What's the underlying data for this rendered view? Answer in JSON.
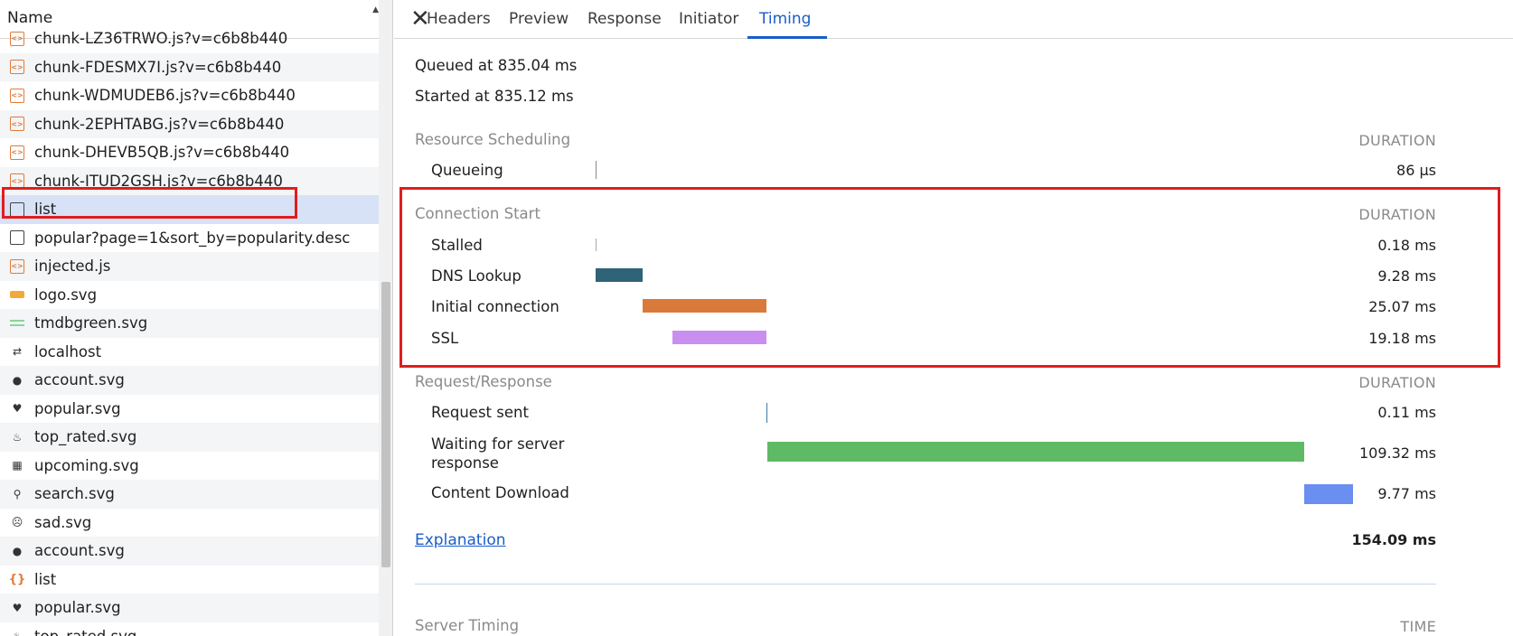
{
  "left_panel": {
    "column_header": "Name",
    "sort_indicator": "▲",
    "requests": [
      {
        "name": "chunk-LZ36TRWO.js?v=c6b8b440",
        "icon": "script-icon",
        "alt": false,
        "selected": false
      },
      {
        "name": "chunk-FDESMX7I.js?v=c6b8b440",
        "icon": "script-icon",
        "alt": true,
        "selected": false
      },
      {
        "name": "chunk-WDMUDEB6.js?v=c6b8b440",
        "icon": "script-icon",
        "alt": false,
        "selected": false
      },
      {
        "name": "chunk-2EPHTABG.js?v=c6b8b440",
        "icon": "script-icon",
        "alt": true,
        "selected": false
      },
      {
        "name": "chunk-DHEVB5QB.js?v=c6b8b440",
        "icon": "script-icon",
        "alt": false,
        "selected": false
      },
      {
        "name": "chunk-ITUD2GSH.js?v=c6b8b440",
        "icon": "script-icon",
        "alt": true,
        "selected": false
      },
      {
        "name": "list",
        "icon": "document-icon",
        "alt": false,
        "selected": true
      },
      {
        "name": "popular?page=1&sort_by=popularity.desc",
        "icon": "document-icon",
        "alt": false,
        "selected": false
      },
      {
        "name": "injected.js",
        "icon": "script-icon",
        "alt": true,
        "selected": false
      },
      {
        "name": "logo.svg",
        "icon": "image-icon",
        "alt": false,
        "selected": false
      },
      {
        "name": "tmdbgreen.svg",
        "icon": "image-green-icon",
        "alt": true,
        "selected": false
      },
      {
        "name": "localhost",
        "icon": "redirect-icon",
        "alt": false,
        "selected": false
      },
      {
        "name": "account.svg",
        "icon": "account-icon",
        "alt": true,
        "selected": false
      },
      {
        "name": "popular.svg",
        "icon": "heart-icon",
        "alt": false,
        "selected": false
      },
      {
        "name": "top_rated.svg",
        "icon": "flame-icon",
        "alt": true,
        "selected": false
      },
      {
        "name": "upcoming.svg",
        "icon": "calendar-icon",
        "alt": false,
        "selected": false
      },
      {
        "name": "search.svg",
        "icon": "search-icon",
        "alt": true,
        "selected": false
      },
      {
        "name": "sad.svg",
        "icon": "sad-face-icon",
        "alt": false,
        "selected": false
      },
      {
        "name": "account.svg",
        "icon": "account-icon",
        "alt": true,
        "selected": false
      },
      {
        "name": "list",
        "icon": "json-icon",
        "alt": false,
        "selected": false
      },
      {
        "name": "popular.svg",
        "icon": "heart-icon",
        "alt": true,
        "selected": false
      },
      {
        "name": "top_rated.svg",
        "icon": "flame-icon",
        "alt": false,
        "selected": false
      }
    ]
  },
  "tabs": {
    "close_label": "✕",
    "items": [
      "Headers",
      "Preview",
      "Response",
      "Initiator",
      "Timing"
    ],
    "active": "Timing"
  },
  "timing": {
    "queued_at": "Queued at 835.04 ms",
    "started_at": "Started at 835.12 ms",
    "duration_header": "DURATION",
    "sections": [
      {
        "title": "Resource Scheduling",
        "rows": [
          {
            "label": "Queueing",
            "value": "86 µs",
            "color": "#8a8a8a"
          }
        ]
      },
      {
        "title": "Connection Start",
        "rows": [
          {
            "label": "Stalled",
            "value": "0.18 ms",
            "color": "#a8a8a8"
          },
          {
            "label": "DNS Lookup",
            "value": "9.28 ms",
            "color": "#2e6378"
          },
          {
            "label": "Initial connection",
            "value": "25.07 ms",
            "color": "#d97a3b"
          },
          {
            "label": "SSL",
            "value": "19.18 ms",
            "color": "#c98ff0"
          }
        ]
      },
      {
        "title": "Request/Response",
        "rows": [
          {
            "label": "Request sent",
            "value": "0.11 ms",
            "color": "#3a7aa8"
          },
          {
            "label": "Waiting for server response",
            "value": "109.32 ms",
            "color": "#5fba65"
          },
          {
            "label": "Content Download",
            "value": "9.77 ms",
            "color": "#6a8ff0"
          }
        ]
      }
    ],
    "explanation_link": "Explanation",
    "total": "154.09 ms",
    "server_timing_title": "Server Timing",
    "server_timing_header": "TIME"
  }
}
